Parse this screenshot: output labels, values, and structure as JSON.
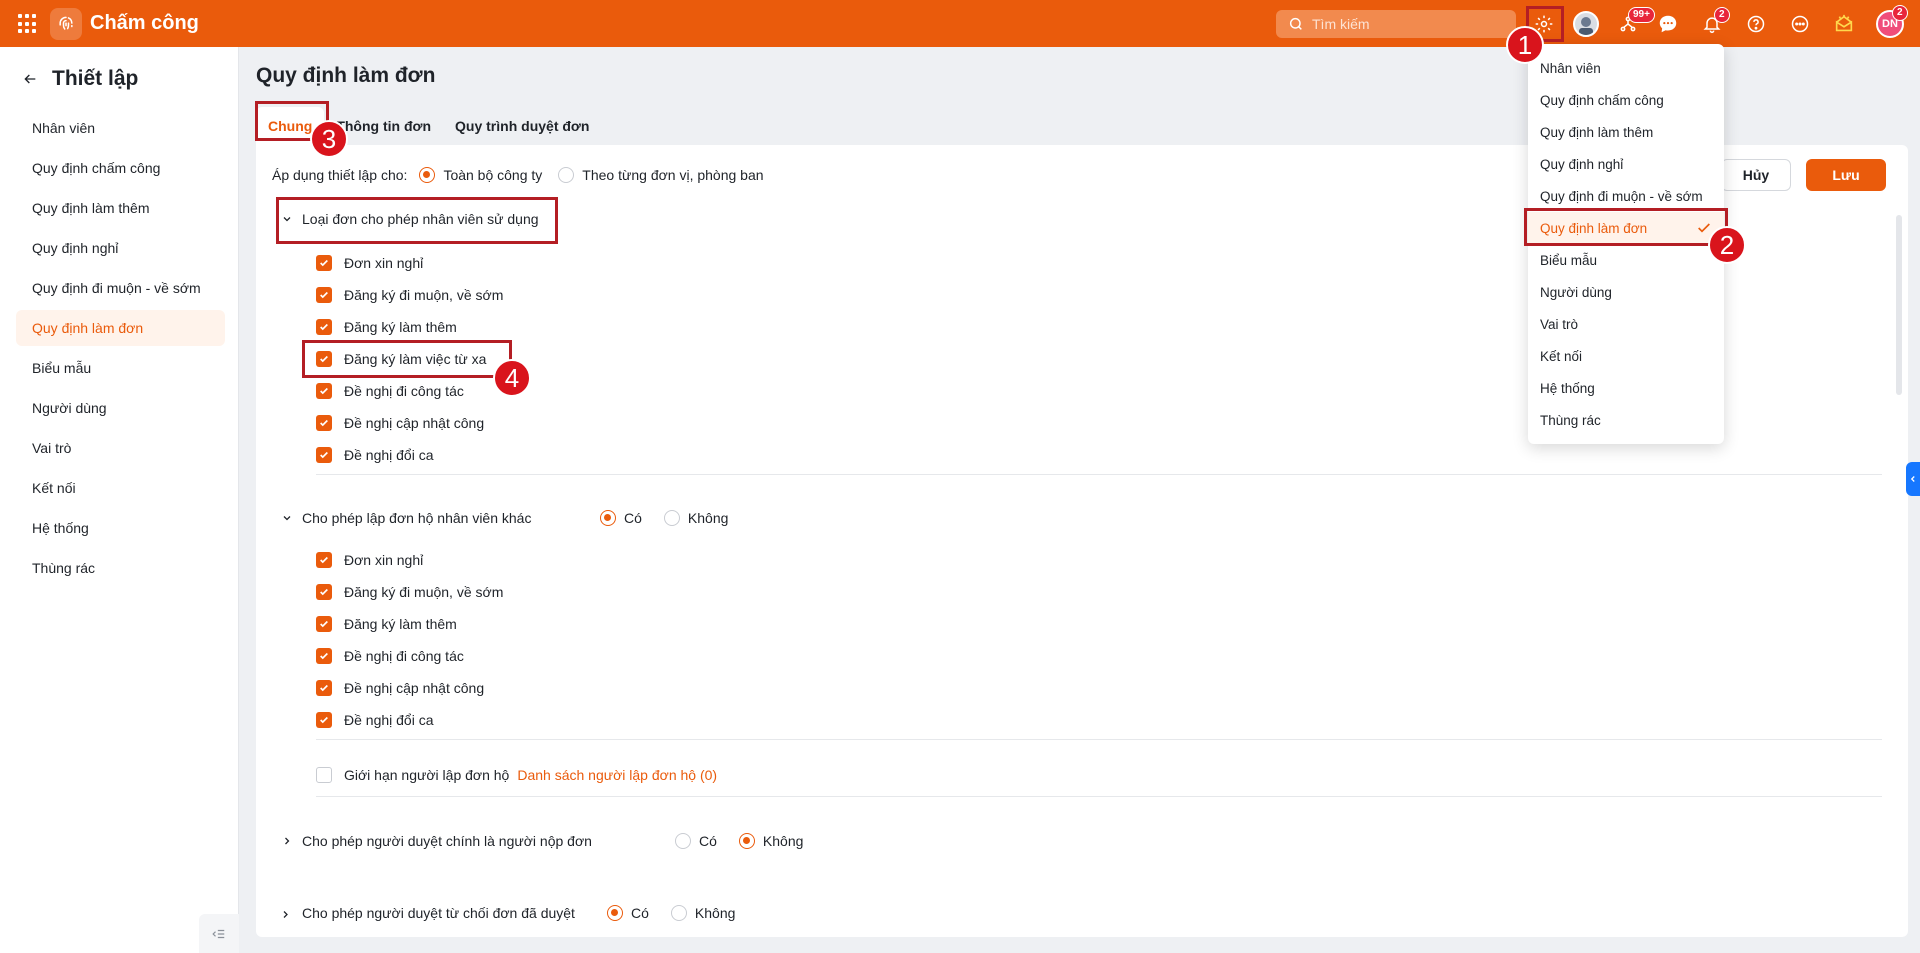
{
  "app": {
    "title": "Chấm công"
  },
  "search": {
    "placeholder": "Tìm kiếm"
  },
  "badges": {
    "shortcuts": "99+",
    "notifications": "2",
    "profile": "2"
  },
  "user": {
    "initials": "DN"
  },
  "sidebar": {
    "title": "Thiết lập",
    "items": [
      {
        "label": "Nhân viên"
      },
      {
        "label": "Quy định chấm công"
      },
      {
        "label": "Quy định làm thêm"
      },
      {
        "label": "Quy định nghỉ"
      },
      {
        "label": "Quy định đi muộn - về sớm"
      },
      {
        "label": "Quy định làm đơn"
      },
      {
        "label": "Biểu mẫu"
      },
      {
        "label": "Người dùng"
      },
      {
        "label": "Vai trò"
      },
      {
        "label": "Kết nối"
      },
      {
        "label": "Hệ thống"
      },
      {
        "label": "Thùng rác"
      }
    ]
  },
  "main": {
    "title": "Quy định làm đơn",
    "tabs": [
      {
        "label": "Chung"
      },
      {
        "label": "Thông tin đơn"
      },
      {
        "label": "Quy trình duyệt đơn"
      }
    ],
    "apply": {
      "label": "Áp dụng thiết lập cho:",
      "opt1": "Toàn bộ công ty",
      "opt2": "Theo từng đơn vị, phòng ban"
    },
    "buttons": {
      "cancel": "Hủy",
      "save": "Lưu"
    },
    "section1": {
      "title": "Loại đơn cho phép nhân viên sử dụng",
      "items": [
        {
          "label": "Đơn xin nghỉ"
        },
        {
          "label": "Đăng ký đi muộn, về sớm"
        },
        {
          "label": "Đăng ký làm thêm"
        },
        {
          "label": "Đăng ký làm việc từ xa"
        },
        {
          "label": "Đề nghị đi công tác"
        },
        {
          "label": "Đề nghị cập nhật công"
        },
        {
          "label": "Đề nghị đổi ca"
        }
      ]
    },
    "section2": {
      "title": "Cho phép lập đơn hộ nhân viên khác",
      "yes": "Có",
      "no": "Không",
      "items": [
        {
          "label": "Đơn xin nghỉ"
        },
        {
          "label": "Đăng ký đi muộn, về sớm"
        },
        {
          "label": "Đăng ký làm thêm"
        },
        {
          "label": "Đề nghị đi công tác"
        },
        {
          "label": "Đề nghị cập nhật công"
        },
        {
          "label": "Đề nghị đổi ca"
        }
      ],
      "limit_label": "Giới hạn người lập đơn hộ",
      "limit_link": "Danh sách người lập đơn hộ (0)"
    },
    "section3": {
      "title": "Cho phép người duyệt chính là người nộp đơn",
      "yes": "Có",
      "no": "Không"
    },
    "section4": {
      "title": "Cho phép người duyệt từ chối đơn đã duyệt",
      "yes": "Có",
      "no": "Không"
    }
  },
  "dropdown": {
    "items": [
      {
        "label": "Nhân viên"
      },
      {
        "label": "Quy định chấm công"
      },
      {
        "label": "Quy định làm thêm"
      },
      {
        "label": "Quy định nghỉ"
      },
      {
        "label": "Quy định đi muộn - về sớm"
      },
      {
        "label": "Quy định làm đơn"
      },
      {
        "label": "Biểu mẫu"
      },
      {
        "label": "Người dùng"
      },
      {
        "label": "Vai trò"
      },
      {
        "label": "Kết nối"
      },
      {
        "label": "Hệ thống"
      },
      {
        "label": "Thùng rác"
      }
    ]
  },
  "annotations": {
    "m1": "1",
    "m2": "2",
    "m3": "3",
    "m4": "4"
  },
  "colors": {
    "brand": "#ea5b0c",
    "highlight": "#b41e24",
    "marker": "#d9141c"
  }
}
